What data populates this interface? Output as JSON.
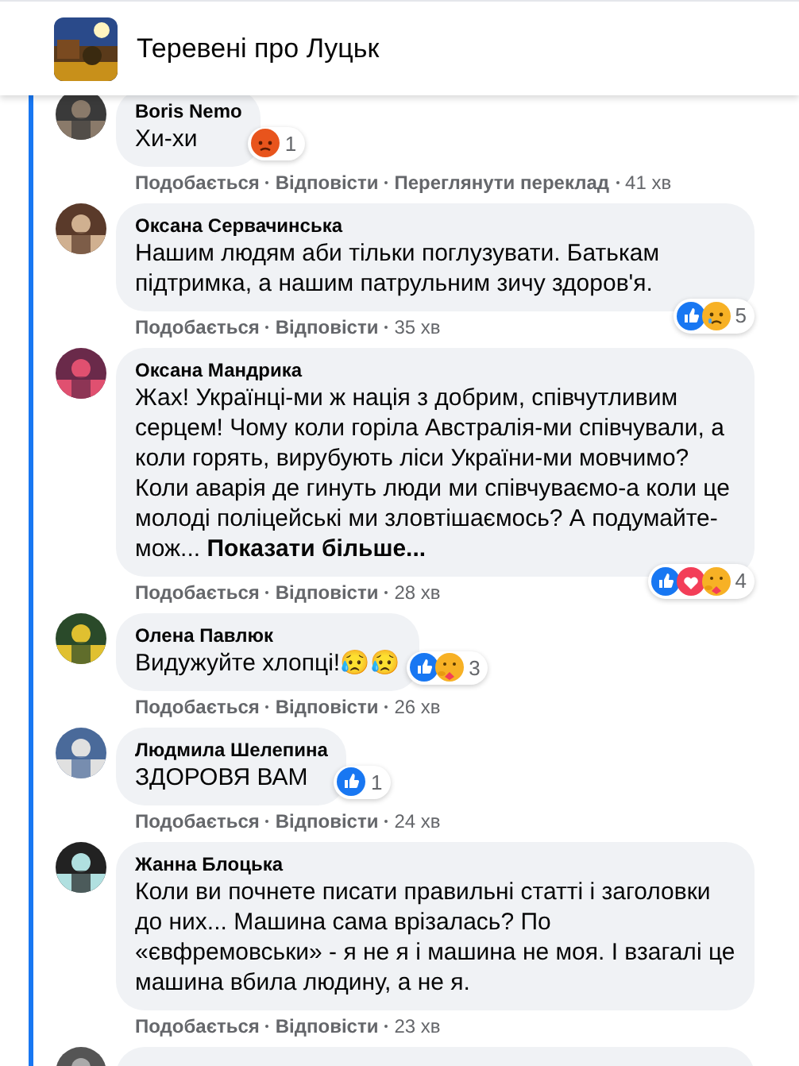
{
  "header": {
    "title": "Теревені про Луцьк"
  },
  "comments": [
    {
      "author": "Boris Nemo",
      "text": "Хи-хи",
      "reactions": {
        "icons": [
          {
            "kind": "angry"
          }
        ],
        "count": "1"
      },
      "actions": [
        "Подобається",
        "Відповісти",
        "Переглянути переклад"
      ],
      "time": "41 хв"
    },
    {
      "author": "Оксана Сервачинська",
      "text": "Нашим людям аби тільки поглузувати. Батькам підтримка, а нашим патрульним зичу здоров'я.",
      "reactions": {
        "icons": [
          {
            "kind": "like"
          },
          {
            "kind": "sad"
          }
        ],
        "count": "5"
      },
      "actions": [
        "Подобається",
        "Відповісти"
      ],
      "time": "35 хв"
    },
    {
      "author": "Оксана Мандрика",
      "text": "Жах! Українці-ми ж нація з добрим, співчутливим серцем! Чому коли горіла Австралія-ми співчували, а коли горять, вирубують ліси України-ми мовчимо? Коли аварія де гинуть люди ми співчуваємо-а коли це молоді поліцейські ми зловтішаємось? А подумайте-мож...",
      "more_link": "Показати більше...",
      "reactions": {
        "icons": [
          {
            "kind": "like"
          },
          {
            "kind": "love"
          },
          {
            "kind": "care"
          }
        ],
        "count": "4"
      },
      "actions": [
        "Подобається",
        "Відповісти"
      ],
      "time": "28 хв"
    },
    {
      "author": "Олена Павлюк",
      "text": "Видужуйте хлопці!😥😥",
      "reactions": {
        "icons": [
          {
            "kind": "like"
          },
          {
            "kind": "care"
          }
        ],
        "count": "3"
      },
      "actions": [
        "Подобається",
        "Відповісти"
      ],
      "time": "26 хв"
    },
    {
      "author": "Людмила Шелепина",
      "text": "ЗДОРОВЯ ВАМ",
      "reactions": {
        "icons": [
          {
            "kind": "like"
          }
        ],
        "count": "1"
      },
      "actions": [
        "Подобається",
        "Відповісти"
      ],
      "time": "24 хв"
    },
    {
      "author": "Жанна Блоцька",
      "text": "Коли ви почнете писати правильні статті і заголовки до них... Машина сама врізалась? По «євфремовськи» - я не я і машина не моя. І взагалі це машина вбила людину, а не я.",
      "actions": [
        "Подобається",
        "Відповісти"
      ],
      "time": "23 хв"
    }
  ]
}
